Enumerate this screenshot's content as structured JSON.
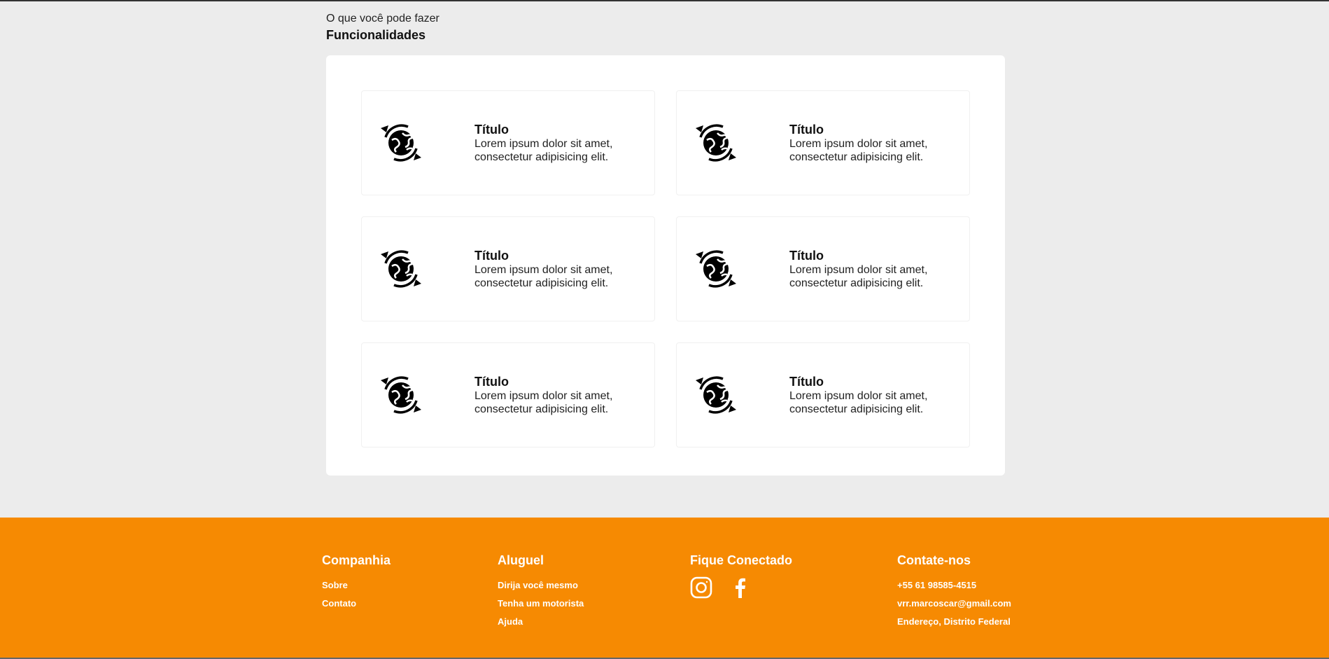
{
  "section": {
    "eyebrow": "O que você pode fazer",
    "heading": "Funcionalidades"
  },
  "features": [
    {
      "title": "Título",
      "description": "Lorem ipsum dolor sit amet, consectetur adipisicing elit.",
      "icon": "globe-sync-icon"
    },
    {
      "title": "Título",
      "description": "Lorem ipsum dolor sit amet, consectetur adipisicing elit.",
      "icon": "globe-sync-icon"
    },
    {
      "title": "Título",
      "description": "Lorem ipsum dolor sit amet, consectetur adipisicing elit.",
      "icon": "globe-sync-icon"
    },
    {
      "title": "Título",
      "description": "Lorem ipsum dolor sit amet, consectetur adipisicing elit.",
      "icon": "globe-sync-icon"
    },
    {
      "title": "Título",
      "description": "Lorem ipsum dolor sit amet, consectetur adipisicing elit.",
      "icon": "globe-sync-icon"
    },
    {
      "title": "Título",
      "description": "Lorem ipsum dolor sit amet, consectetur adipisicing elit.",
      "icon": "globe-sync-icon"
    }
  ],
  "footer": {
    "background": "#f68a02",
    "companhia": {
      "title": "Companhia",
      "links": [
        "Sobre",
        "Contato"
      ]
    },
    "aluguel": {
      "title": "Aluguel",
      "links": [
        "Dirija você mesmo",
        "Tenha um motorista",
        "Ajuda"
      ]
    },
    "fique": {
      "title": "Fique Conectado",
      "icons": [
        "instagram-icon",
        "facebook-icon"
      ]
    },
    "contato": {
      "title": "Contate-nos",
      "items": [
        "+55 61 98585-4515",
        "vrr.marcoscar@gmail.com",
        "Endereço, Distrito Federal"
      ]
    }
  }
}
